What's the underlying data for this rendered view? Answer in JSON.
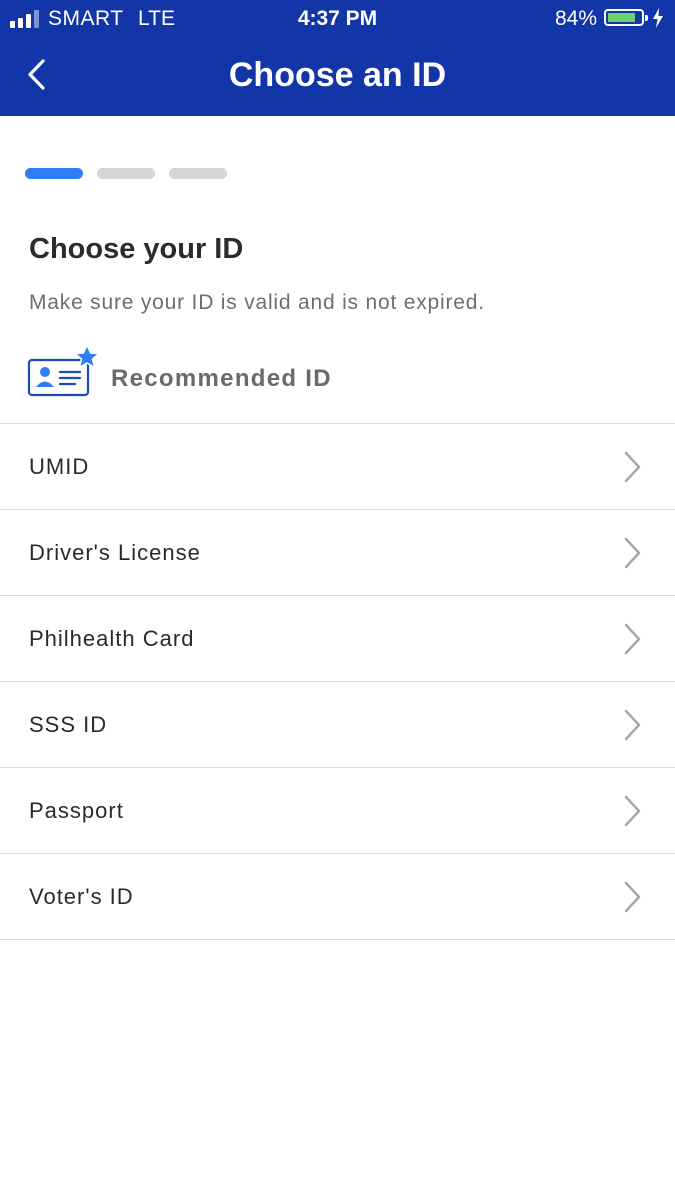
{
  "status_bar": {
    "carrier": "SMART",
    "network": "LTE",
    "time": "4:37 PM",
    "battery_percent": "84%",
    "battery_level": 0.84,
    "signal_bars_filled": 3,
    "signal_bars_total": 4,
    "battery_color": "#6bd36b"
  },
  "header": {
    "title": "Choose an ID",
    "back_icon": "chevron-left-icon",
    "background_color": "#1236a8"
  },
  "progress": {
    "total_steps": 3,
    "current_step": 1,
    "active_color": "#2f7df2",
    "inactive_color": "#d6d6d6"
  },
  "main": {
    "heading": "Choose your ID",
    "subtitle": "Make sure your ID is valid and is not expired.",
    "recommended_label": "Recommended ID",
    "recommended_icon": "id-card-star-icon"
  },
  "id_options": [
    {
      "label": "UMID"
    },
    {
      "label": "Driver's License"
    },
    {
      "label": "Philhealth Card"
    },
    {
      "label": "SSS ID"
    },
    {
      "label": "Passport"
    },
    {
      "label": "Voter's ID"
    }
  ]
}
